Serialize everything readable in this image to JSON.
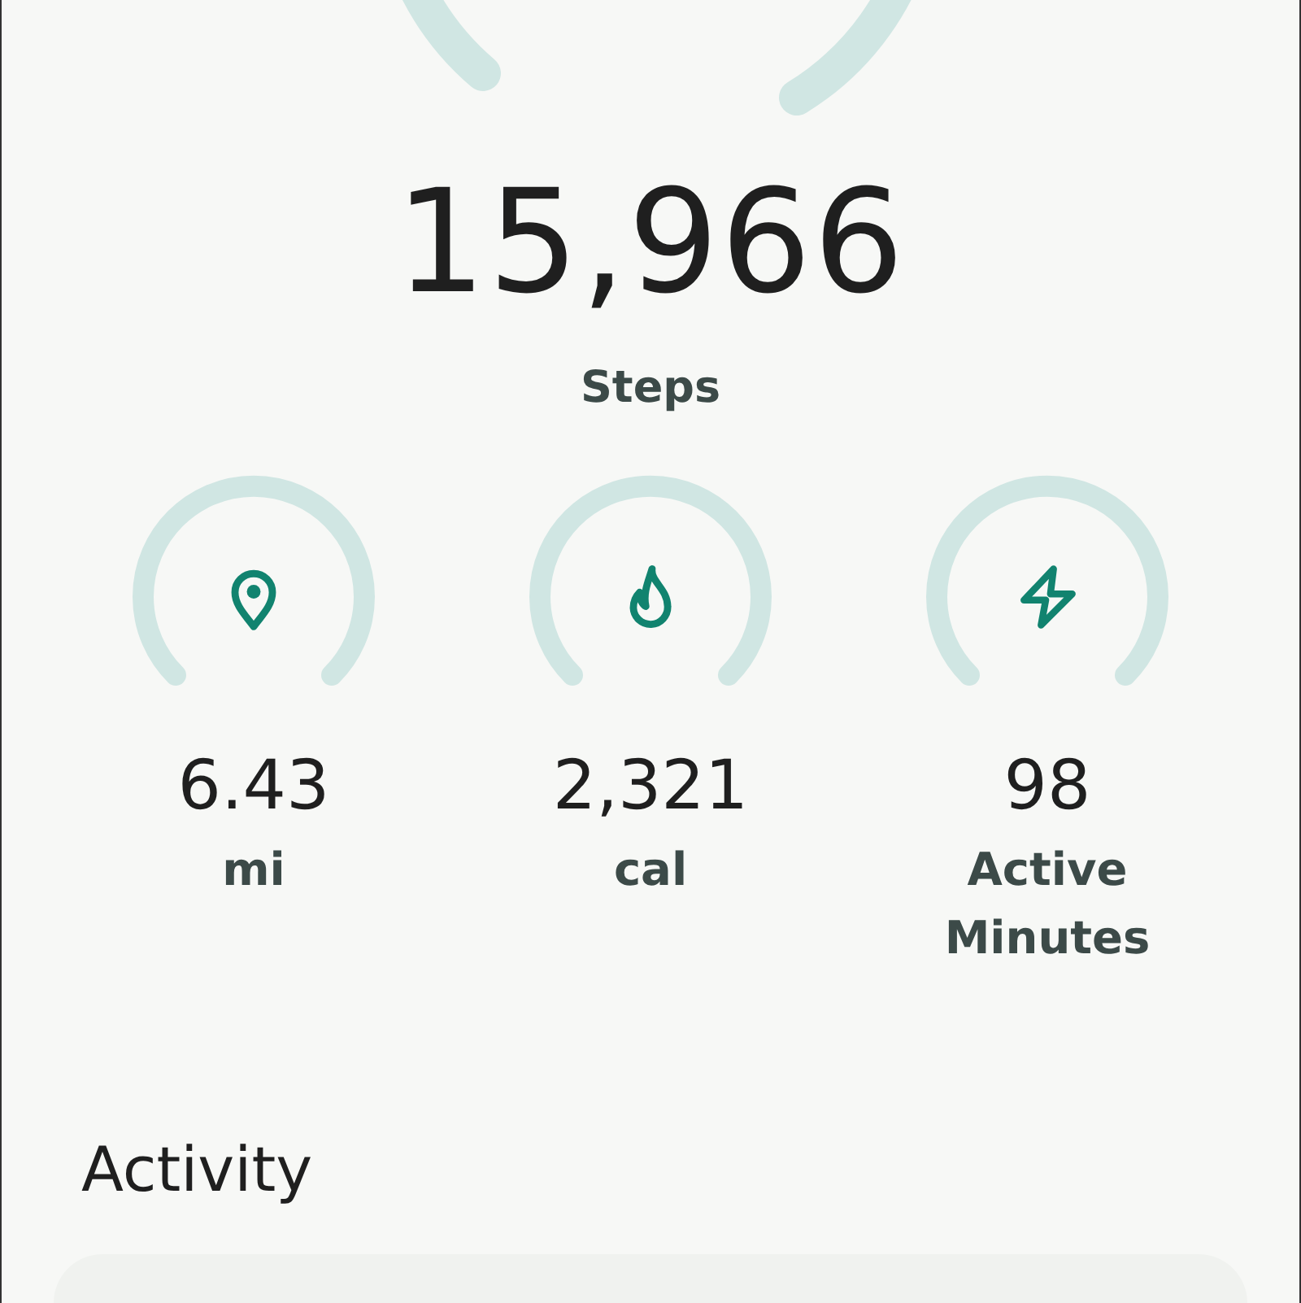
{
  "steps": {
    "value": "15,966",
    "label": "Steps"
  },
  "metrics": [
    {
      "kind": "distance",
      "value": "6.43",
      "label": "mi"
    },
    {
      "kind": "calories",
      "value": "2,321",
      "label": "cal"
    },
    {
      "kind": "active",
      "value": "98",
      "label": "Active Minutes"
    }
  ],
  "section": {
    "title": "Activity"
  }
}
